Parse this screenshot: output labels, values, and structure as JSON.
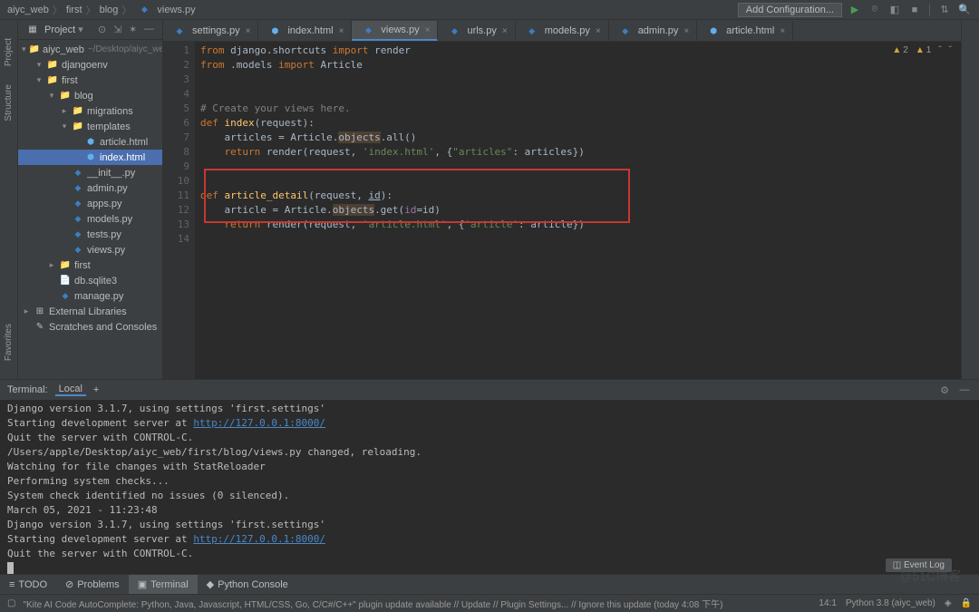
{
  "breadcrumbs": {
    "project": "aiyc_web",
    "folder": "first",
    "subfolder": "blog",
    "file": "views.py"
  },
  "top": {
    "add_config": "Add Configuration..."
  },
  "sidebar": {
    "title": "Project",
    "root": {
      "name": "aiyc_web",
      "path": "~/Desktop/aiyc_we"
    },
    "tree": [
      {
        "indent": 1,
        "arrow": "▾",
        "icon": "folder",
        "label": "djangoenv",
        "cls": ""
      },
      {
        "indent": 1,
        "arrow": "▾",
        "icon": "folder",
        "label": "first"
      },
      {
        "indent": 2,
        "arrow": "▾",
        "icon": "folder",
        "label": "blog"
      },
      {
        "indent": 3,
        "arrow": "▸",
        "icon": "folder",
        "label": "migrations"
      },
      {
        "indent": 3,
        "arrow": "▾",
        "icon": "folder",
        "label": "templates"
      },
      {
        "indent": 4,
        "arrow": "",
        "icon": "html",
        "label": "article.html"
      },
      {
        "indent": 4,
        "arrow": "",
        "icon": "html",
        "label": "index.html",
        "selected": true
      },
      {
        "indent": 3,
        "arrow": "",
        "icon": "py",
        "label": "__init__.py"
      },
      {
        "indent": 3,
        "arrow": "",
        "icon": "py",
        "label": "admin.py"
      },
      {
        "indent": 3,
        "arrow": "",
        "icon": "py",
        "label": "apps.py"
      },
      {
        "indent": 3,
        "arrow": "",
        "icon": "py",
        "label": "models.py"
      },
      {
        "indent": 3,
        "arrow": "",
        "icon": "py",
        "label": "tests.py"
      },
      {
        "indent": 3,
        "arrow": "",
        "icon": "py",
        "label": "views.py"
      },
      {
        "indent": 2,
        "arrow": "▸",
        "icon": "folder",
        "label": "first"
      },
      {
        "indent": 2,
        "arrow": "",
        "icon": "file",
        "label": "db.sqlite3"
      },
      {
        "indent": 2,
        "arrow": "",
        "icon": "py",
        "label": "manage.py"
      },
      {
        "indent": 0,
        "arrow": "▸",
        "icon": "lib",
        "label": "External Libraries"
      },
      {
        "indent": 0,
        "arrow": "",
        "icon": "scratch",
        "label": "Scratches and Consoles"
      }
    ]
  },
  "tabs": [
    {
      "icon": "py",
      "label": "settings.py"
    },
    {
      "icon": "html",
      "label": "index.html"
    },
    {
      "icon": "py",
      "label": "views.py",
      "active": true
    },
    {
      "icon": "py",
      "label": "urls.py"
    },
    {
      "icon": "py",
      "label": "models.py"
    },
    {
      "icon": "py",
      "label": "admin.py"
    },
    {
      "icon": "html",
      "label": "article.html"
    }
  ],
  "editor": {
    "warnings": {
      "w1_count": "2",
      "w2_count": "1"
    },
    "lines": 14
  },
  "terminal": {
    "title": "Terminal:",
    "tab": "Local",
    "lines": [
      "Django version 3.1.7, using settings 'first.settings'",
      "Starting development server at ",
      "Quit the server with CONTROL-C.",
      "/Users/apple/Desktop/aiyc_web/first/blog/views.py changed, reloading.",
      "Watching for file changes with StatReloader",
      "Performing system checks...",
      "",
      "System check identified no issues (0 silenced).",
      "March 05, 2021 - 11:23:48",
      "Django version 3.1.7, using settings 'first.settings'",
      "Starting development server at ",
      "Quit the server with CONTROL-C."
    ],
    "url": "http://127.0.0.1:8000/"
  },
  "bottom_tabs": {
    "todo": "TODO",
    "problems": "Problems",
    "terminal": "Terminal",
    "python_console": "Python Console"
  },
  "status": {
    "kite": "\"Kite AI Code AutoComplete: Python, Java, Javascript, HTML/CSS, Go, C/C#/C++\" plugin update available // Update // Plugin Settings... // Ignore this update (today 4:08 下午)",
    "cursor": "14:1",
    "python": "Python 3.8 (aiyc_web)",
    "event_log": "Event Log"
  },
  "left_gutter": {
    "project": "Project",
    "structure": "Structure",
    "favorites": "Favorites"
  },
  "watermark": "@51C博客"
}
